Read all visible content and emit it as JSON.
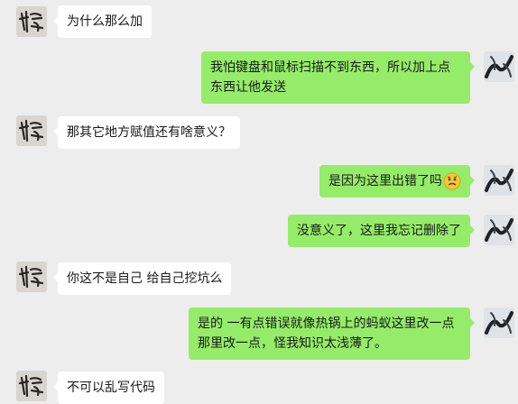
{
  "chat": {
    "messages": [
      {
        "side": "in",
        "text": "为什么那么加"
      },
      {
        "side": "out",
        "text": "我怕键盘和鼠标扫描不到东西，所以加上点东西让他发送"
      },
      {
        "side": "in",
        "text": "那其它地方赋值还有啥意义？"
      },
      {
        "side": "out",
        "text": "是因为这里出错了吗",
        "emoji": "confused-face-emoji"
      },
      {
        "side": "out",
        "text": "没意义了，这里我忘记删除了"
      },
      {
        "side": "in",
        "text": "你这不是自己 给自己挖坑么"
      },
      {
        "side": "out",
        "text": "是的 一有点错误就像热锅上的蚂蚁这里改一点那里改一点，怪我知识太浅薄了。"
      },
      {
        "side": "in",
        "text": "不可以乱写代码"
      }
    ],
    "colors": {
      "background": "#ededed",
      "incoming_bubble": "#ffffff",
      "outgoing_bubble": "#95ec69",
      "text": "#191919"
    }
  }
}
